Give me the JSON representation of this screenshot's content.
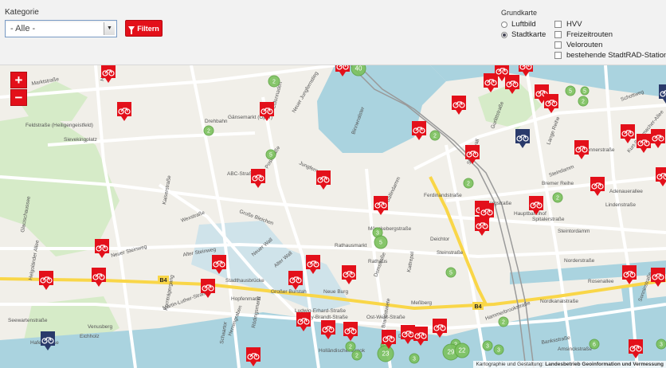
{
  "filter": {
    "category_label": "Kategorie",
    "category_value": "- Alle -",
    "filter_button": "Filtern"
  },
  "basemap": {
    "title": "Grundkarte",
    "options": [
      {
        "label": "Luftbild",
        "checked": false
      },
      {
        "label": "Stadtkarte",
        "checked": true
      }
    ]
  },
  "layers": [
    {
      "label": "HVV",
      "checked": false
    },
    {
      "label": "Freizeitrouten",
      "checked": false
    },
    {
      "label": "Velorouten",
      "checked": false
    },
    {
      "label": "bestehende StadtRAD-Stationen",
      "checked": false
    }
  ],
  "map": {
    "zoom_in": "+",
    "zoom_out": "−",
    "attribution_prefix": "Kartographie und Gestaltung: ",
    "attribution_source": "Landesbetrieb Geoinformation und Vermessung",
    "colors": {
      "marker": "#e3101a",
      "marker_special": "#2a3a6b",
      "cluster": "#7cc25e",
      "water": "#aad3df",
      "road_major": "#f9d648"
    },
    "street_labels": [
      "Marktstraße",
      "Holstenwall",
      "Feldstraße (Heiligengeistfeld)",
      "Sievekingplatz",
      "Drehbahn",
      "Gänsemarkt (Oper)",
      "Colonnaden",
      "Neuer Jungfernstieg",
      "Binnenalster",
      "ABC-Straße",
      "Poststraße",
      "Jungfernstieg",
      "Glacischaussee",
      "Kaiserstraße",
      "Wexstraße",
      "Große Bleichen",
      "Neuer Steinweg",
      "Alter Steinweg",
      "Neuer Wall",
      "Alter Wall",
      "Stadthausbrücke",
      "Mönckebergstraße",
      "Rathaus",
      "Rathausmarkt",
      "Steinstraße",
      "Domstraße",
      "Kattrepel",
      "Brandstwiete",
      "Meßberg",
      "Willy-Brandt-Straße",
      "Ost-West-Straße",
      "Martin-Luther-Straße",
      "Venusberg",
      "Eichholz",
      "Seewartenstraße",
      "Hafenstraße",
      "Helgoländer Allee",
      "Kornträgergang",
      "Ballindamm",
      "Lange Reihe",
      "Steintorwall",
      "Hauptbahnhof",
      "Spitalerstraße",
      "Bergstraße",
      "Steintordamm",
      "Norderstraße",
      "Rosenallee",
      "Nordkanalstraße",
      "Amsinckstraße",
      "Banksstraße",
      "Hammerbrookstraße",
      "Sonninstraße",
      "Schottweg",
      "Kurt-Schumacher-Allee",
      "Adenauerallee",
      "Steindamm",
      "Brennerstraße",
      "Bremer Reihe",
      "Lindenstraße",
      "Gurlittstraße",
      "Ferdinandstraße",
      "Dovenfleet",
      "Holländischer Brook",
      "Deichtor",
      "Schaartor",
      "Herrengraben",
      "Rödingsmarkt",
      "Großer Burstah",
      "Neue Burg",
      "Ludwig-Erhard-Straße",
      "Hopfenmarkt"
    ],
    "route_labels": [
      "B4",
      "B4"
    ],
    "cluster_counts": [
      "40",
      "2",
      "2",
      "5",
      "2",
      "5",
      "2",
      "2",
      "2",
      "3",
      "5",
      "5",
      "2",
      "6",
      "3",
      "2",
      "2",
      "2",
      "2",
      "3",
      "23",
      "29",
      "22",
      "3",
      "5",
      "3"
    ]
  }
}
